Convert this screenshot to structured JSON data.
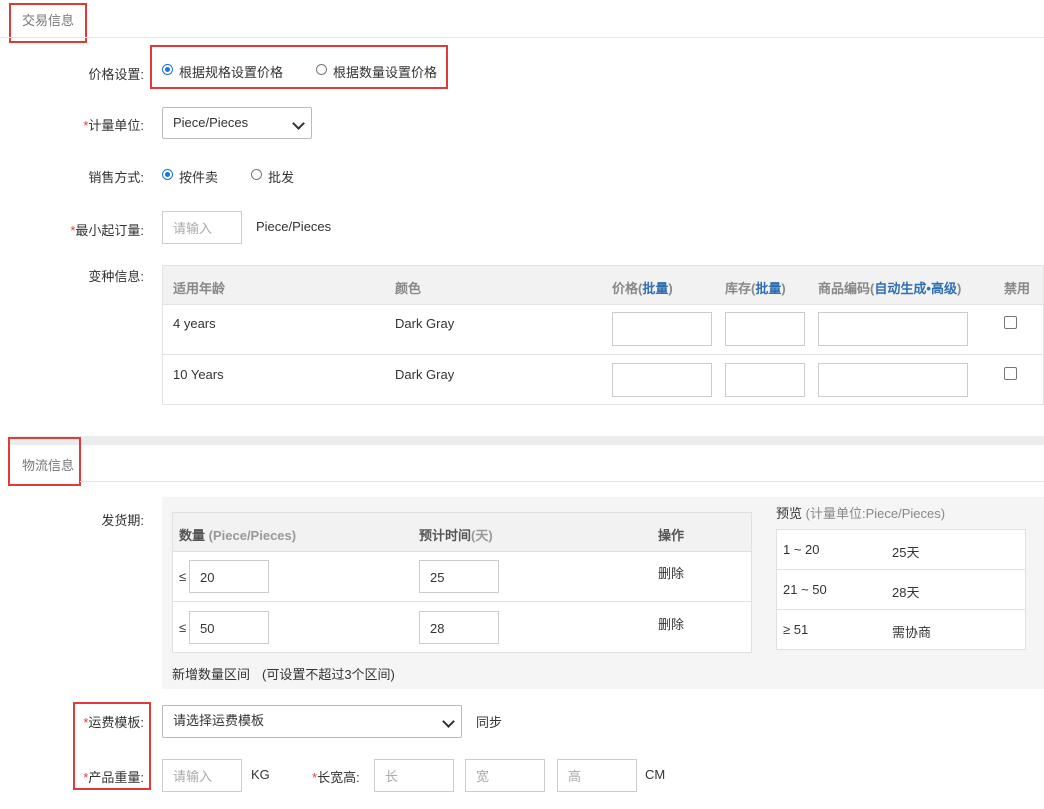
{
  "trade": {
    "section_title": "交易信息",
    "price_setting": {
      "label": "价格设置:",
      "options": [
        "根据规格设置价格",
        "根据数量设置价格"
      ],
      "selected": 0
    },
    "unit": {
      "label": "计量单位:",
      "value": "Piece/Pieces"
    },
    "sale_method": {
      "label": "销售方式:",
      "options": [
        "按件卖",
        "批发"
      ],
      "selected": 0
    },
    "moq": {
      "label": "最小起订量:",
      "placeholder": "请输入",
      "unit": "Piece/Pieces"
    },
    "variants": {
      "label": "变种信息:",
      "headers": {
        "age": "适用年龄",
        "color": "颜色",
        "price": "价格",
        "price_batch": "批量",
        "stock": "库存",
        "stock_batch": "批量",
        "sku": "商品编码",
        "sku_auto": "自动生成",
        "sku_adv": "高级",
        "disable": "禁用"
      },
      "rows": [
        {
          "age": "4 years",
          "color": "Dark Gray"
        },
        {
          "age": "10 Years",
          "color": "Dark Gray"
        }
      ]
    }
  },
  "logistics": {
    "section_title": "物流信息",
    "delivery": {
      "label": "发货期:",
      "headers": {
        "qty": "数量",
        "qty_unit": "(Piece/Pieces)",
        "days": "预计时间",
        "days_unit": "(天)",
        "action": "操作"
      },
      "rows": [
        {
          "prefix": "≤",
          "qty": "20",
          "days": "25",
          "action": "删除"
        },
        {
          "prefix": "≤",
          "qty": "50",
          "days": "28",
          "action": "删除"
        }
      ],
      "add_link": "新增数量区间",
      "add_note": "(可设置不超过3个区间)",
      "preview_title": "预览",
      "preview_unit_note": "(计量单位:Piece/Pieces)",
      "preview_rows": [
        {
          "range": "1 ~ 20",
          "days": "25天"
        },
        {
          "range": "21 ~ 50",
          "days": "28天"
        },
        {
          "range": "≥ 51",
          "days": "需协商"
        }
      ]
    },
    "freight": {
      "label": "运费模板:",
      "value": "请选择运费模板",
      "sync": "同步"
    },
    "weight": {
      "label": "产品重量:",
      "placeholder": "请输入",
      "unit": "KG"
    },
    "dimensions": {
      "label": "长宽高:",
      "length_ph": "长",
      "width_ph": "宽",
      "height_ph": "高",
      "unit": "CM"
    }
  },
  "colors": {
    "highlight_red": "#e03a3a",
    "link_blue": "#2f6fb3",
    "radio_blue": "#1a73e8"
  }
}
